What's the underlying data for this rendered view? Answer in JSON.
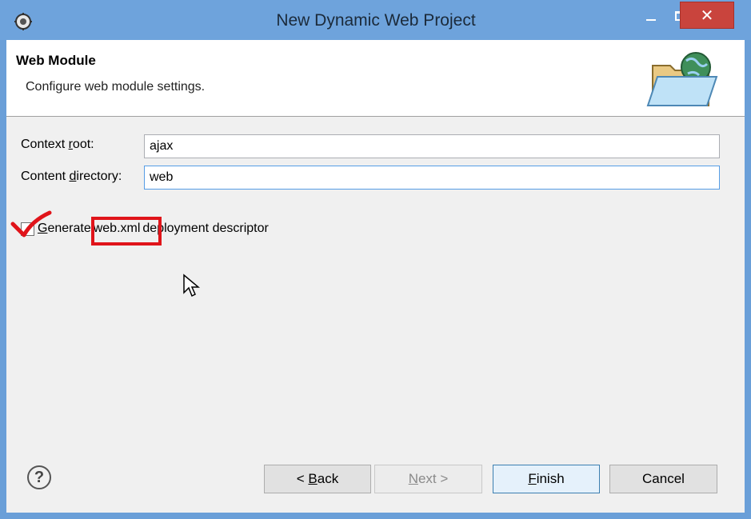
{
  "window": {
    "title": "New Dynamic Web Project",
    "title_bar_color": "#6ea3dc",
    "close_color": "#c9443d"
  },
  "header": {
    "title": "Web Module",
    "description": "Configure web module settings."
  },
  "form": {
    "context_root": {
      "label_pre": "Context ",
      "label_mnemonic": "r",
      "label_post": "oot:",
      "value": "ajax"
    },
    "content_directory": {
      "label_pre": "Content ",
      "label_mnemonic": "d",
      "label_post": "irectory:",
      "value": "web"
    },
    "generate_descriptor": {
      "label_mnemonic": "G",
      "label_pre": "enerate",
      "label_highlight": "web.xml",
      "label_post": "deployment descriptor",
      "checked": false
    }
  },
  "annotation": {
    "highlight_color": "#e0141a"
  },
  "buttons": {
    "back": {
      "pre": "< ",
      "mnemonic": "B",
      "post": "ack"
    },
    "next": {
      "mnemonic": "N",
      "post": "ext >"
    },
    "finish": {
      "mnemonic": "F",
      "post": "inish"
    },
    "cancel": "Cancel"
  },
  "icons": {
    "app": "eclipse-gear-icon",
    "help": "help-icon",
    "header": "folder-globe-icon"
  }
}
